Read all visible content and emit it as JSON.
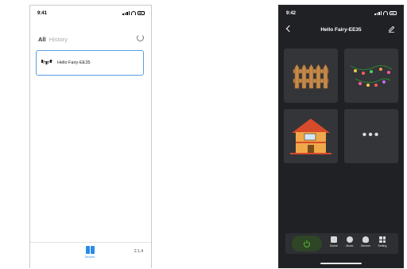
{
  "left_screen": {
    "status": {
      "time": "9:41"
    },
    "header": {
      "all": "All",
      "history": "History"
    },
    "device": {
      "name": "Hello Fairy-EE35"
    },
    "bottom_bar": {
      "devices_label": "Devices",
      "version": "2.1.4"
    },
    "colors": {
      "accent": "#2a8be8",
      "card_border": "#5aa0e0"
    }
  },
  "right_screen": {
    "status": {
      "time": "9:42"
    },
    "nav": {
      "title": "Hello Fairy-EE35"
    },
    "tiles": [
      {
        "icon": "fence-icon"
      },
      {
        "icon": "string-lights-icon"
      },
      {
        "icon": "house-icon"
      },
      {
        "icon": "more-icon"
      }
    ],
    "controls": {
      "items": [
        {
          "label": "Scene",
          "icon": "scene-icon"
        },
        {
          "label": "Music",
          "icon": "music-icon"
        },
        {
          "label": "Dimmer",
          "icon": "dimmer-icon"
        },
        {
          "label": "Setting",
          "icon": "setting-icon"
        }
      ]
    },
    "colors": {
      "background": "#1f2124",
      "tile": "#333539",
      "power_green": "#5bbf3a"
    }
  }
}
